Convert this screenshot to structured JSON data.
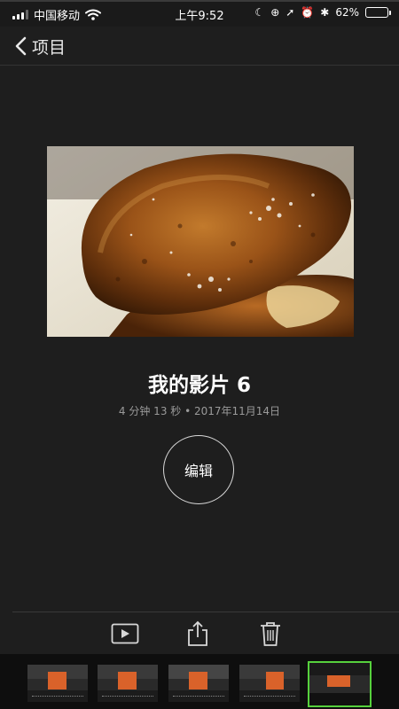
{
  "status_bar": {
    "carrier": "中国移动",
    "time": "上午9:52",
    "battery_percent": "62%",
    "battery_level": 0.62
  },
  "nav": {
    "back_label": "项目"
  },
  "movie": {
    "title": "我的影片 6",
    "meta": "4 分钟 13 秒 • 2017年11月14日"
  },
  "actions": {
    "edit_label": "编辑"
  },
  "toolbar": {
    "icons": [
      "play-icon",
      "share-icon",
      "trash-icon"
    ]
  },
  "filmstrip": {
    "count": 5,
    "selected_index": 4
  },
  "colors": {
    "background": "#1e1e1e",
    "accent_selected": "#56d13d",
    "thumb_orange": "#d9622a"
  }
}
